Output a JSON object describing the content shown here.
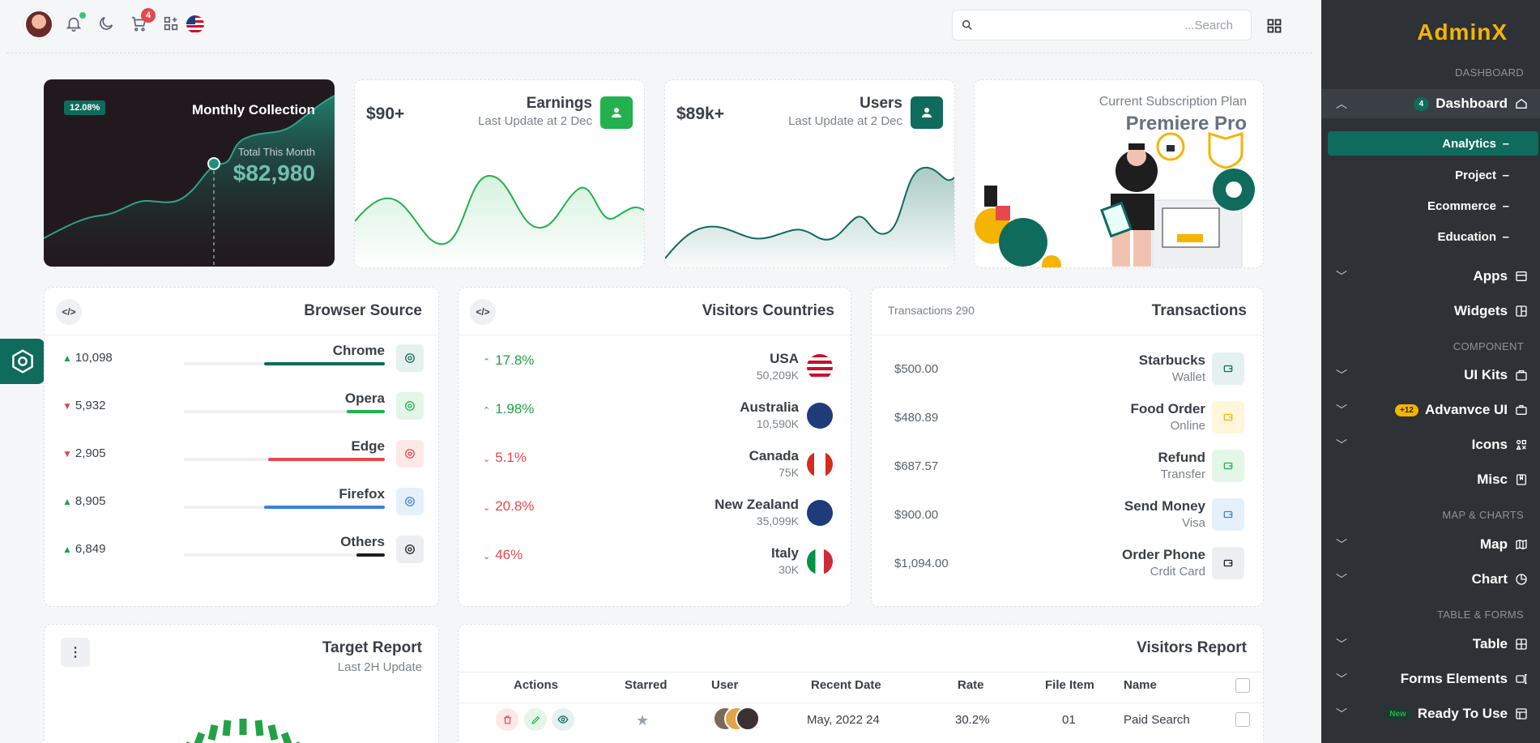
{
  "topbar": {
    "cart_count": "4",
    "search_placeholder": "...Search"
  },
  "sidebar": {
    "logo": "AdminX",
    "sections": {
      "dashboard": "DASHBOARD",
      "component": "COMPONENT",
      "map_charts": "MAP & CHARTS",
      "table_forms": "TABLE & FORMS"
    },
    "dashboard": {
      "label": "Dashboard",
      "badge": "4"
    },
    "sub_items": [
      "Analytics",
      "Project",
      "Ecommerce",
      "Education"
    ],
    "items": {
      "apps": "Apps",
      "widgets": "Widgets",
      "ui_kits": "UI Kits",
      "advanced_ui": "Advanvce UI",
      "advanced_badge": "+12",
      "icons": "Icons",
      "misc": "Misc",
      "map": "Map",
      "chart": "Chart",
      "table": "Table",
      "forms": "Forms Elements",
      "ready": "Ready To Use",
      "ready_badge": "New"
    }
  },
  "cards": {
    "monthly": {
      "badge": "12.08%",
      "title": "Monthly Collection",
      "sub": "Total This Month",
      "value": "$82,980"
    },
    "earnings": {
      "value": "$90+",
      "title": "Earnings",
      "sub": "Last Update at 2 Dec"
    },
    "users": {
      "value": "$89k+",
      "title": "Users",
      "sub": "Last Update at 2 Dec"
    },
    "subscription": {
      "label": "Current Subscription Plan",
      "plan": "Premiere Pro"
    }
  },
  "browser": {
    "title": "Browser Source",
    "rows": [
      {
        "value": "10,098",
        "name": "Chrome",
        "trend": "up",
        "fill": 0.6,
        "color": "#0f6b5c"
      },
      {
        "value": "5,932",
        "name": "Opera",
        "trend": "down",
        "fill": 0.19,
        "color": "#22b14c"
      },
      {
        "value": "2,905",
        "name": "Edge",
        "trend": "down",
        "fill": 0.58,
        "color": "#e5484d"
      },
      {
        "value": "8,905",
        "name": "Firefox",
        "trend": "up",
        "fill": 0.6,
        "color": "#3b82d6"
      },
      {
        "value": "6,849",
        "name": "Others",
        "trend": "up",
        "fill": 0.14,
        "color": "#1e1e1e"
      }
    ]
  },
  "countries": {
    "title": "Visitors Countries",
    "rows": [
      {
        "pct": "17.8%",
        "trend": "up",
        "name": "USA",
        "visitors": "50,209K"
      },
      {
        "pct": "1.98%",
        "trend": "up",
        "name": "Australia",
        "visitors": "10,590K"
      },
      {
        "pct": "5.1%",
        "trend": "down",
        "name": "Canada",
        "visitors": "75K"
      },
      {
        "pct": "20.8%",
        "trend": "down",
        "name": "New Zealand",
        "visitors": "35,099K"
      },
      {
        "pct": "46%",
        "trend": "down",
        "name": "Italy",
        "visitors": "30K"
      }
    ]
  },
  "transactions": {
    "title": "Transactions",
    "count": "Transactions 290",
    "rows": [
      {
        "amount": "$500.00",
        "name": "Starbucks",
        "sub": "Wallet"
      },
      {
        "amount": "$480.89",
        "name": "Food Order",
        "sub": "Online"
      },
      {
        "amount": "$687.57",
        "name": "Refund",
        "sub": "Transfer"
      },
      {
        "amount": "$900.00",
        "name": "Send Money",
        "sub": "Visa"
      },
      {
        "amount": "$1,094.00",
        "name": "Order Phone",
        "sub": "Crdit Card"
      }
    ]
  },
  "target": {
    "title": "Target Report",
    "sub": "Last 2H Update"
  },
  "visitors_report": {
    "title": "Visitors Report",
    "headers": [
      "Actions",
      "Starred",
      "User",
      "Recent Date",
      "Rate",
      "File Item",
      "Name"
    ],
    "row": {
      "date": "May, 2022 24",
      "rate": "30.2%",
      "file": "01",
      "name": "Paid Search"
    }
  }
}
